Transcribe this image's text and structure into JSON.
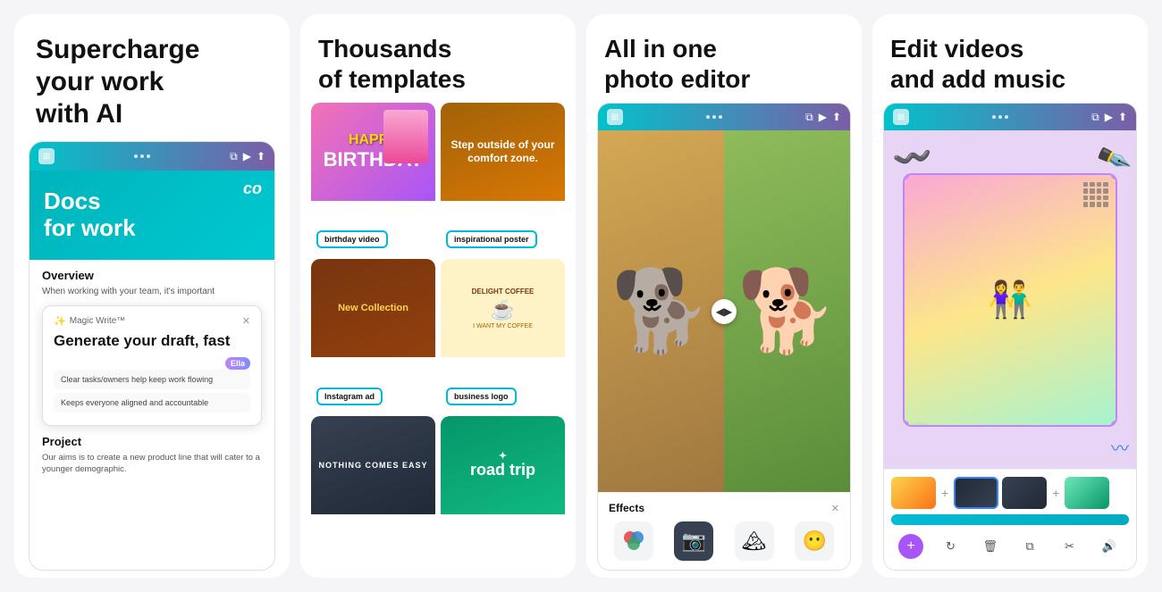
{
  "panel1": {
    "heading_line1": "Supercharge",
    "heading_line2": "your work",
    "heading_line3": "with AI",
    "docs_title_line1": "Docs",
    "docs_title_line2": "for work",
    "docs_logo": "co",
    "overview_title": "Overview",
    "overview_text": "When working with your team, it's important",
    "magic_write_label": "Magic Write™",
    "magic_write_headline": "Generate your draft, fast",
    "ella_name": "Ella",
    "task1": "Clear tasks/owners help keep work flowing",
    "task2": "Keeps everyone aligned and accountable",
    "project_title": "Project",
    "project_text": "Our aims is to create a new product line that will cater to a younger demographic."
  },
  "panel2": {
    "heading_line1": "Thousands",
    "heading_line2": "of templates",
    "template1_label": "birthday video",
    "template2_label": "inspirational poster",
    "template3_label": "Instagram ad",
    "template4_label": "business logo",
    "tpl1_text1": "HAPPY",
    "tpl1_text2": "BIRTHDAY",
    "tpl2_text": "Step outside of your comfort zone.",
    "tpl3_text": "New Collection",
    "tpl4_name": "DELIGHT COFFEE",
    "tpl5_text": "NOTHING COMES EASY",
    "tpl6_text": "road trip"
  },
  "panel3": {
    "heading_line1": "All in one",
    "heading_line2": "photo editor",
    "effects_title": "Effects",
    "effects_close": "✕"
  },
  "panel4": {
    "heading_line1": "Edit videos",
    "heading_line2": "and add music"
  },
  "colors": {
    "accent_blue": "#00bcd4",
    "accent_purple": "#a855f7",
    "brand_gradient_start": "#00c2cb",
    "brand_gradient_end": "#7b5ea7"
  }
}
